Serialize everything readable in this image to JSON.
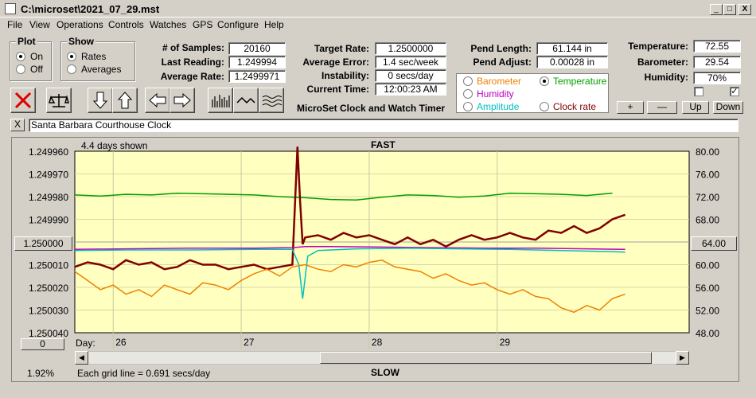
{
  "window": {
    "title": "C:\\microset\\2021_07_29.mst",
    "minimize": "_",
    "maximize": "□",
    "close": "X"
  },
  "menu": [
    "File",
    "View",
    "Operations",
    "Controls",
    "Watches",
    "GPS",
    "Configure",
    "Help"
  ],
  "plot_group": {
    "title": "Plot",
    "on": "On",
    "off": "Off",
    "selected": "On"
  },
  "show_group": {
    "title": "Show",
    "rates": "Rates",
    "averages": "Averages",
    "selected": "Rates"
  },
  "stats": {
    "samples_label": "# of Samples:",
    "samples": "20160",
    "last_label": "Last Reading:",
    "last": "1.249994",
    "avg_label": "Average Rate:",
    "avg": "1.2499971"
  },
  "target": {
    "rate_label": "Target Rate:",
    "rate": "1.2500000",
    "error_label": "Average Error:",
    "error": "1.4 sec/week",
    "instab_label": "Instability:",
    "instab": "0 secs/day",
    "time_label": "Current Time:",
    "time": "12:00:23 AM",
    "caption": "MicroSet Clock and Watch Timer"
  },
  "pend": {
    "length_label": "Pend Length:",
    "length": "61.144 in",
    "adjust_label": "Pend Adjust:",
    "adjust": "0.00028 in"
  },
  "env": {
    "temp_label": "Temperature:",
    "temp": "72.55",
    "baro_label": "Barometer:",
    "baro": "29.54",
    "hum_label": "Humidity:",
    "hum": "70%"
  },
  "overlay_options": {
    "barometer": "Barometer",
    "temperature": "Temperature",
    "humidity": "Humidity",
    "amplitude": "Amplitude",
    "clock_rate": "Clock rate",
    "selected": "Temperature",
    "colors": {
      "barometer": "#f08000",
      "temperature": "#00a000",
      "humidity": "#c000c0",
      "amplitude": "#00c0c0",
      "clock_rate": "#800000"
    }
  },
  "adjust_buttons": {
    "plus": "+",
    "minus": "—",
    "up": "Up",
    "down": "Down"
  },
  "clock_name": {
    "close": "X",
    "value": "Santa Barbara Courthouse Clock"
  },
  "chart_buttons": {
    "center_left": "1.250000",
    "center_right": "64.00",
    "offset": "0"
  },
  "chart_footer": {
    "percent": "1.92%",
    "grid_note": "Each grid line = 0.691 secs/day"
  },
  "chart_data": {
    "type": "line",
    "top_label": "FAST",
    "bottom_label": "SLOW",
    "days_shown": "4.4 days shown",
    "day_prefix": "Day:",
    "day_ticks": [
      "26",
      "27",
      "28",
      "29"
    ],
    "left_ticks": [
      "1.249960",
      "1.249970",
      "1.249980",
      "1.249990",
      "1.250000",
      "1.250010",
      "1.250020",
      "1.250030",
      "1.250040"
    ],
    "right_ticks": [
      "80.00",
      "76.00",
      "72.00",
      "68.00",
      "64.00",
      "60.00",
      "56.00",
      "52.00",
      "48.00"
    ],
    "left_ylim": [
      1.24996,
      1.25004
    ],
    "right_ylim": [
      48,
      80
    ],
    "xlim": [
      25.6,
      30.4
    ],
    "series": [
      {
        "color": "#00a000",
        "axis": "right",
        "x": [
          25.6,
          25.8,
          26.0,
          26.2,
          26.4,
          26.6,
          26.8,
          27.0,
          27.2,
          27.4,
          27.6,
          27.8,
          28.0,
          28.2,
          28.4,
          28.6,
          28.8,
          29.0,
          29.2,
          29.4,
          29.6,
          29.8
        ],
        "y": [
          72.3,
          72.1,
          72.4,
          72.3,
          72.6,
          72.5,
          72.4,
          72.3,
          72.0,
          71.8,
          71.5,
          71.4,
          71.9,
          72.3,
          72.2,
          71.9,
          72.1,
          72.6,
          72.5,
          72.4,
          72.2,
          72.6
        ]
      },
      {
        "color": "#800000",
        "axis": "left",
        "x": [
          25.6,
          25.7,
          25.8,
          25.9,
          26.0,
          26.1,
          26.2,
          26.3,
          26.4,
          26.5,
          26.6,
          26.7,
          26.8,
          26.9,
          27.0,
          27.1,
          27.2,
          27.3,
          27.34,
          27.36,
          27.38,
          27.4,
          27.5,
          27.6,
          27.7,
          27.8,
          27.9,
          28.0,
          28.1,
          28.2,
          28.3,
          28.4,
          28.5,
          28.6,
          28.7,
          28.8,
          28.9,
          29.0,
          29.1,
          29.2,
          29.3,
          29.4,
          29.5,
          29.6,
          29.7,
          29.8,
          29.9
        ],
        "y": [
          1.250011,
          1.250009,
          1.25001,
          1.250012,
          1.250008,
          1.25001,
          1.250009,
          1.250012,
          1.250011,
          1.250008,
          1.25001,
          1.25001,
          1.250012,
          1.250011,
          1.25001,
          1.250012,
          1.250011,
          1.25001,
          1.249958,
          1.249982,
          1.250001,
          1.249998,
          1.249997,
          1.249999,
          1.249996,
          1.249998,
          1.249997,
          1.249999,
          1.250001,
          1.249998,
          1.250001,
          1.249999,
          1.250002,
          1.249999,
          1.249997,
          1.249999,
          1.249998,
          1.249996,
          1.249998,
          1.249999,
          1.249995,
          1.249996,
          1.249993,
          1.249996,
          1.249994,
          1.24999,
          1.249988
        ]
      },
      {
        "color": "#c000c0",
        "axis": "right",
        "x": [
          25.6,
          26.0,
          26.5,
          27.0,
          27.3,
          27.4,
          27.6,
          28.0,
          28.4,
          28.8,
          29.2,
          29.6,
          29.9
        ],
        "y": [
          62.7,
          62.8,
          62.9,
          62.9,
          63.0,
          63.2,
          63.2,
          63.1,
          63.0,
          62.9,
          62.9,
          62.8,
          62.7
        ]
      },
      {
        "color": "#00c0c0",
        "axis": "right",
        "x": [
          25.6,
          26.0,
          26.5,
          27.0,
          27.3,
          27.35,
          27.38,
          27.42,
          27.5,
          27.8,
          28.2,
          28.6,
          29.0,
          29.4,
          29.8,
          29.9
        ],
        "y": [
          62.5,
          62.6,
          62.6,
          62.7,
          62.7,
          60.0,
          54.0,
          61.5,
          62.5,
          62.8,
          62.9,
          62.8,
          62.7,
          62.5,
          62.3,
          62.2
        ]
      },
      {
        "color": "#f08000",
        "axis": "left",
        "x": [
          25.6,
          25.7,
          25.8,
          25.9,
          26.0,
          26.1,
          26.2,
          26.3,
          26.4,
          26.5,
          26.6,
          26.7,
          26.8,
          26.9,
          27.0,
          27.1,
          27.2,
          27.3,
          27.4,
          27.5,
          27.6,
          27.7,
          27.8,
          27.9,
          28.0,
          28.1,
          28.2,
          28.3,
          28.4,
          28.5,
          28.6,
          28.7,
          28.8,
          28.9,
          29.0,
          29.1,
          29.2,
          29.3,
          29.4,
          29.5,
          29.6,
          29.7,
          29.8,
          29.9
        ],
        "y": [
          1.250013,
          1.250017,
          1.250021,
          1.250019,
          1.250023,
          1.250021,
          1.250024,
          1.250019,
          1.250021,
          1.250023,
          1.250018,
          1.250019,
          1.250021,
          1.250017,
          1.250014,
          1.250012,
          1.250015,
          1.250011,
          1.25001,
          1.250012,
          1.250013,
          1.25001,
          1.250011,
          1.250009,
          1.250008,
          1.250011,
          1.250012,
          1.250013,
          1.250016,
          1.250014,
          1.250017,
          1.250019,
          1.250018,
          1.250021,
          1.250023,
          1.250021,
          1.250024,
          1.250025,
          1.250029,
          1.250031,
          1.250028,
          1.25003,
          1.250025,
          1.250023
        ]
      }
    ]
  }
}
